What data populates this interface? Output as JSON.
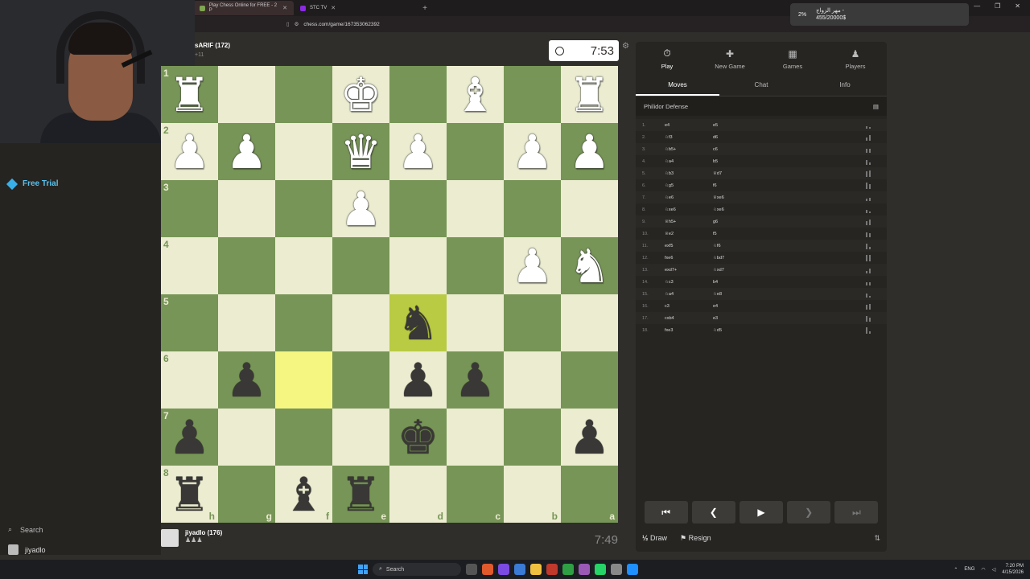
{
  "browser": {
    "tabs": [
      {
        "label": "Play Chess Online for FREE - 2 P",
        "color": "#7fa650",
        "active": true
      },
      {
        "label": "STC TV",
        "color": "#8a2be2",
        "active": false
      }
    ],
    "url": "chess.com/game/167353062392"
  },
  "notification": {
    "percent": "2%",
    "title": "مهر الزواج -",
    "amount": "455/20000$"
  },
  "sidebar": {
    "free_trial": "Free Trial",
    "search": "Search",
    "username": "jiyadlo",
    "badges": [
      "1",
      "1"
    ]
  },
  "opponent": {
    "name": "sARIF (172)",
    "material": "+11",
    "clock": "7:53"
  },
  "player": {
    "name": "jiyadlo (176)",
    "captured": "♟♟♟",
    "clock": "7:49"
  },
  "board": {
    "ranks": [
      "1",
      "2",
      "3",
      "4",
      "5",
      "6",
      "7",
      "8"
    ],
    "files": [
      "h",
      "g",
      "f",
      "e",
      "d",
      "c",
      "b",
      "a"
    ],
    "squares": [
      [
        [
          "wR",
          ""
        ],
        [
          "",
          ""
        ],
        [
          "",
          ""
        ],
        [
          "wK",
          ""
        ],
        [
          "",
          ""
        ],
        [
          "wB",
          ""
        ],
        [
          "",
          ""
        ],
        [
          "wR",
          ""
        ]
      ],
      [
        [
          "wP",
          ""
        ],
        [
          "wP",
          ""
        ],
        [
          "",
          ""
        ],
        [
          "wQ",
          ""
        ],
        [
          "wP",
          ""
        ],
        [
          "",
          ""
        ],
        [
          "wP",
          ""
        ],
        [
          "wP",
          ""
        ]
      ],
      [
        [
          "",
          ""
        ],
        [
          "",
          ""
        ],
        [
          "",
          ""
        ],
        [
          "wP",
          ""
        ],
        [
          "",
          ""
        ],
        [
          "",
          ""
        ],
        [
          "",
          ""
        ],
        [
          "",
          ""
        ]
      ],
      [
        [
          "",
          ""
        ],
        [
          "",
          ""
        ],
        [
          "",
          ""
        ],
        [
          "",
          ""
        ],
        [
          "",
          ""
        ],
        [
          "",
          ""
        ],
        [
          "wP",
          ""
        ],
        [
          "wN",
          ""
        ]
      ],
      [
        [
          "",
          ""
        ],
        [
          "",
          ""
        ],
        [
          "",
          ""
        ],
        [
          "",
          ""
        ],
        [
          "bN",
          "hl"
        ],
        [
          "",
          ""
        ],
        [
          "",
          ""
        ],
        [
          "",
          ""
        ]
      ],
      [
        [
          "",
          ""
        ],
        [
          "bP",
          ""
        ],
        [
          "",
          "hl"
        ],
        [
          "",
          ""
        ],
        [
          "bP",
          ""
        ],
        [
          "bP",
          ""
        ],
        [
          "",
          ""
        ],
        [
          "",
          ""
        ]
      ],
      [
        [
          "bP",
          ""
        ],
        [
          "",
          ""
        ],
        [
          "",
          ""
        ],
        [
          "",
          ""
        ],
        [
          "bK",
          ""
        ],
        [
          "",
          ""
        ],
        [
          "",
          ""
        ],
        [
          "bP",
          ""
        ]
      ],
      [
        [
          "bR",
          ""
        ],
        [
          "",
          ""
        ],
        [
          "bB",
          ""
        ],
        [
          "bR",
          ""
        ],
        [
          "",
          ""
        ],
        [
          "",
          ""
        ],
        [
          "",
          ""
        ],
        [
          "",
          ""
        ]
      ]
    ]
  },
  "panel": {
    "nav": [
      {
        "label": "Play",
        "icon": "⏱"
      },
      {
        "label": "New Game",
        "icon": "✚"
      },
      {
        "label": "Games",
        "icon": "▦"
      },
      {
        "label": "Players",
        "icon": "♟"
      }
    ],
    "subtabs": [
      "Moves",
      "Chat",
      "Info"
    ],
    "opening": "Philidor Defense",
    "moves": [
      [
        "1.",
        "e4",
        "e5"
      ],
      [
        "2.",
        "♘f3",
        "d6"
      ],
      [
        "3.",
        "♘b5+",
        "c6"
      ],
      [
        "4.",
        "♘a4",
        "b5"
      ],
      [
        "5.",
        "♘b3",
        "♕d7"
      ],
      [
        "6.",
        "♘g5",
        "f6"
      ],
      [
        "7.",
        "♘e6",
        "♕xe6"
      ],
      [
        "8.",
        "♘xe6",
        "♘xe6"
      ],
      [
        "9.",
        "♕h5+",
        "g6"
      ],
      [
        "10.",
        "♕e2",
        "f5"
      ],
      [
        "11.",
        "exf5",
        "♘f6"
      ],
      [
        "12.",
        "fxe6",
        "♘bd7"
      ],
      [
        "13.",
        "exd7+",
        "♘xd7"
      ],
      [
        "14.",
        "♘c3",
        "b4"
      ],
      [
        "15.",
        "♘a4",
        "♘e8"
      ],
      [
        "16.",
        "c3",
        "e4"
      ],
      [
        "17.",
        "cxb4",
        "e3"
      ],
      [
        "18.",
        "fxe3",
        "♘d5"
      ]
    ],
    "actions": {
      "draw": "Draw",
      "resign": "Resign",
      "draw_icon": "½"
    }
  },
  "taskbar": {
    "search": "Search",
    "lang": "ENG",
    "time": "7:20 PM",
    "date": "4/15/2026"
  }
}
